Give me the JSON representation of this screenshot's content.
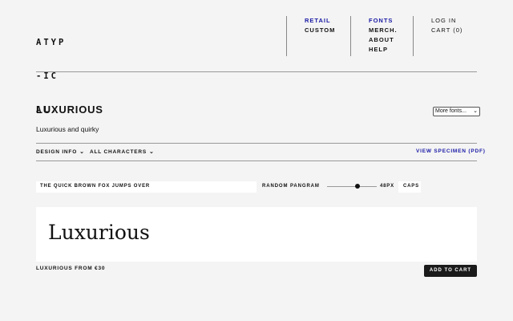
{
  "logo": {
    "line1": "ATYP",
    "line2": "-IC",
    "line3": "AL."
  },
  "nav": {
    "col1": [
      "RETAIL",
      "CUSTOM"
    ],
    "col2": [
      "FONTS",
      "MERCH.",
      "ABOUT",
      "HELP"
    ],
    "col3": [
      "LOG IN",
      "CART (0)"
    ]
  },
  "colors": {
    "accent": "#1a1aa6",
    "button_bg": "#1a1a1a"
  },
  "font": {
    "name": "LUXURIOUS",
    "description": "Luxurious and quirky",
    "select_label": "More fonts..."
  },
  "tabs": {
    "design_info": "DESIGN INFO",
    "all_characters": "ALL CHARACTERS",
    "specimen": "VIEW SPECIMEN (PDF)"
  },
  "tester": {
    "pangram": "THE QUICK BROWN FOX JUMPS OVER",
    "random": "RANDOM PANGRAM",
    "size": "48PX",
    "caps": "CAPS",
    "preview": "Luxurious"
  },
  "purchase": {
    "from": "LUXURIOUS FROM €30",
    "add_to_cart": "ADD TO CART"
  },
  "icons": {
    "dropdown": "chevron-down-icon"
  }
}
